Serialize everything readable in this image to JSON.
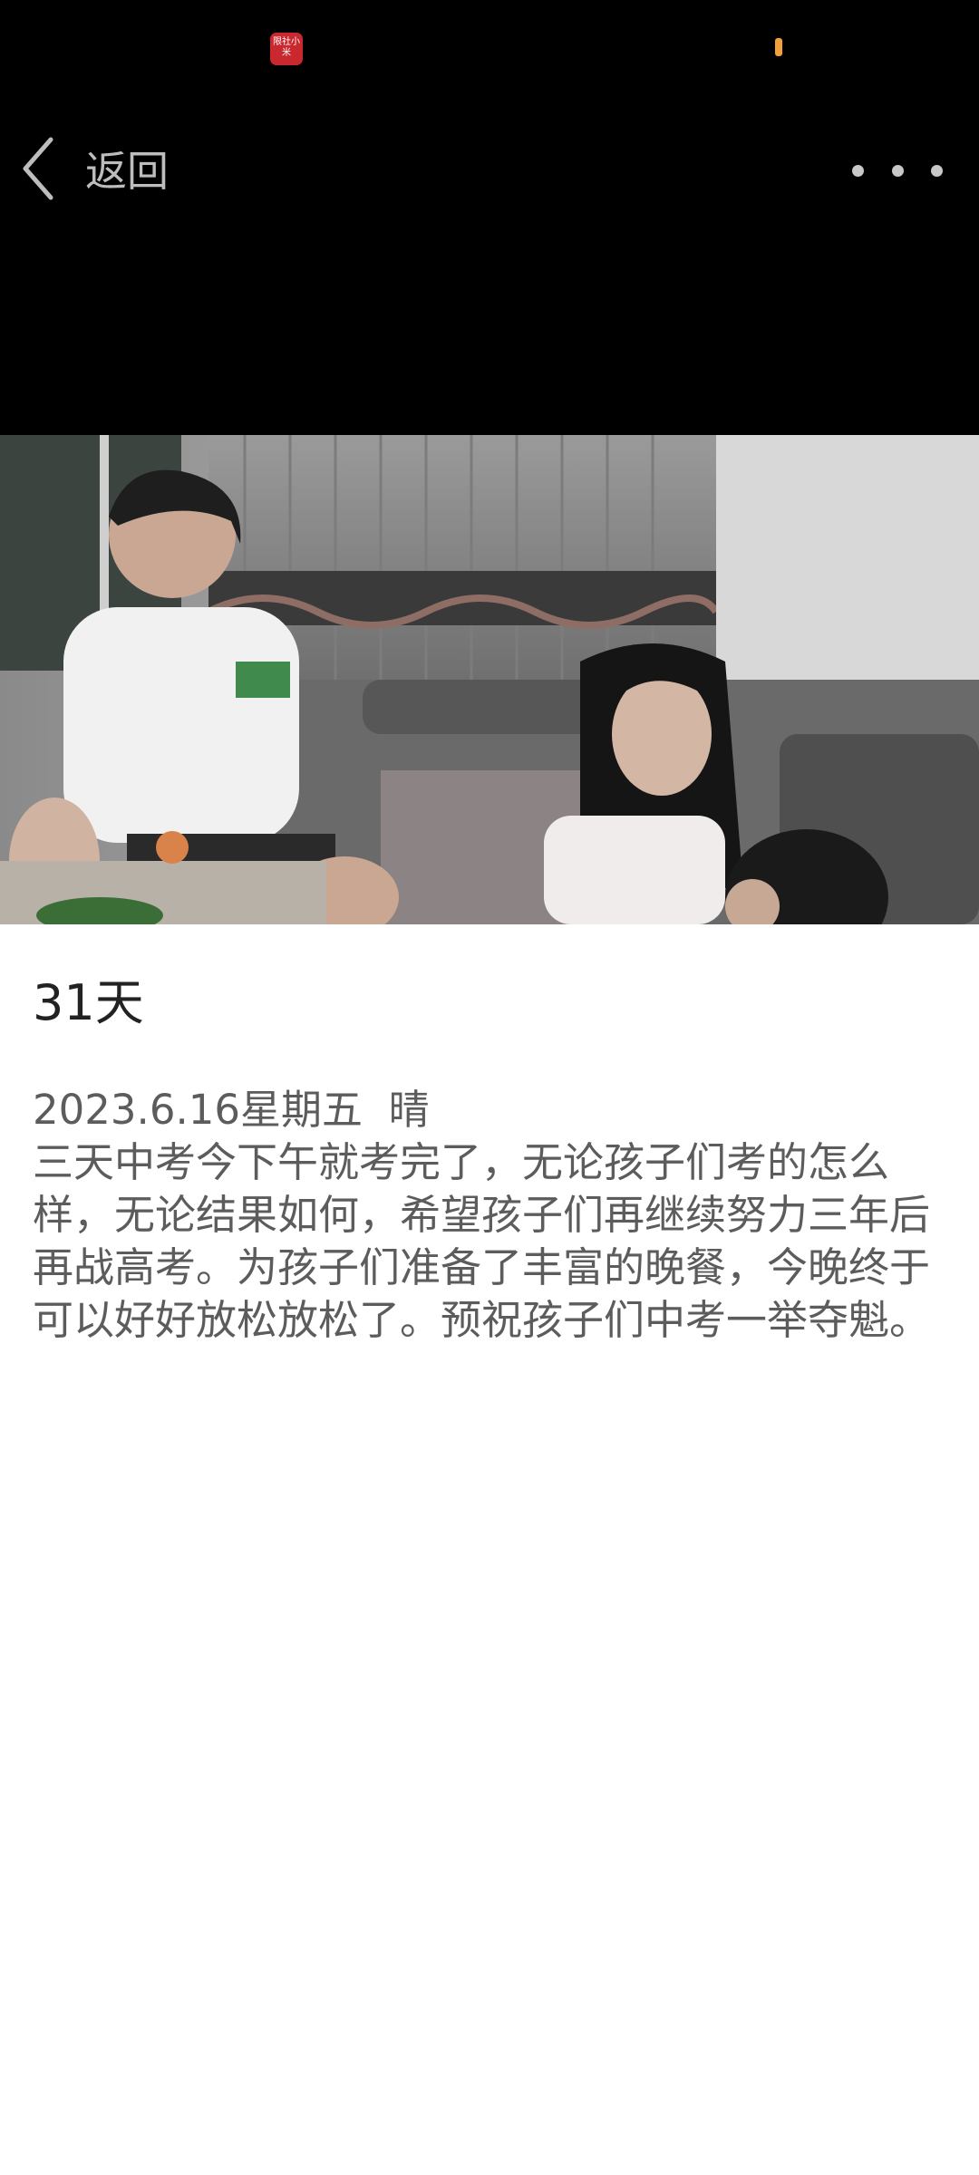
{
  "status_bar": {
    "app_badge_text": "限社小米",
    "indicator_color": "#f2a13a",
    "badge_color": "#c9282f"
  },
  "nav": {
    "back_label": "返回",
    "back_icon": "chevron-left-icon",
    "more_icon": "more-horizontal-icon"
  },
  "entry": {
    "title": "31天",
    "date_line": "2023.6.16星期五  晴",
    "body": "三天中考今下午就考完了，无论孩子们考的怎么样，无论结果如何，希望孩子们再继续努力三年后再战高考。为孩子们准备了丰富的晚餐，今晚终于可以好好放松放松了。预祝孩子们中考一举夺魁。"
  },
  "colors": {
    "header_bg": "#000000",
    "content_bg": "#ffffff",
    "title_text": "#222222",
    "body_text": "#5c5c5c",
    "nav_text": "#bdbdbd"
  }
}
